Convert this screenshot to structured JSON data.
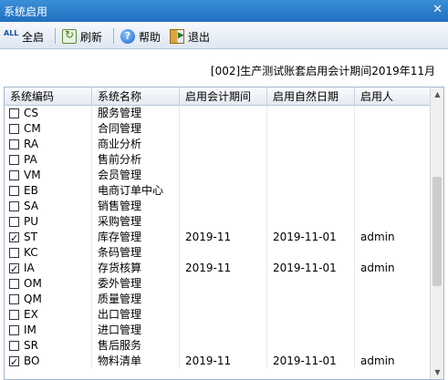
{
  "window": {
    "title": "系统启用",
    "close_glyph": "✕"
  },
  "toolbar": {
    "all_icon_text": "ALL",
    "all_label": "全启",
    "refresh_label": "刷新",
    "help_label": "帮助",
    "exit_label": "退出"
  },
  "period_text": "[002]生产测试账套启用会计期间2019年11月",
  "table": {
    "headers": [
      "系统编码",
      "系统名称",
      "启用会计期间",
      "启用自然日期",
      "启用人"
    ],
    "rows": [
      {
        "checked": false,
        "code": "CS",
        "name": "服务管理",
        "period": "",
        "date": "",
        "user": ""
      },
      {
        "checked": false,
        "code": "CM",
        "name": "合同管理",
        "period": "",
        "date": "",
        "user": ""
      },
      {
        "checked": false,
        "code": "RA",
        "name": "商业分析",
        "period": "",
        "date": "",
        "user": ""
      },
      {
        "checked": false,
        "code": "PA",
        "name": "售前分析",
        "period": "",
        "date": "",
        "user": ""
      },
      {
        "checked": false,
        "code": "VM",
        "name": "会员管理",
        "period": "",
        "date": "",
        "user": ""
      },
      {
        "checked": false,
        "code": "EB",
        "name": "电商订单中心",
        "period": "",
        "date": "",
        "user": ""
      },
      {
        "checked": false,
        "code": "SA",
        "name": "销售管理",
        "period": "",
        "date": "",
        "user": ""
      },
      {
        "checked": false,
        "code": "PU",
        "name": "采购管理",
        "period": "",
        "date": "",
        "user": ""
      },
      {
        "checked": true,
        "code": "ST",
        "name": "库存管理",
        "period": "2019-11",
        "date": "2019-11-01",
        "user": "admin"
      },
      {
        "checked": false,
        "code": "KC",
        "name": "条码管理",
        "period": "",
        "date": "",
        "user": ""
      },
      {
        "checked": true,
        "code": "IA",
        "name": "存货核算",
        "period": "2019-11",
        "date": "2019-11-01",
        "user": "admin"
      },
      {
        "checked": false,
        "code": "OM",
        "name": "委外管理",
        "period": "",
        "date": "",
        "user": ""
      },
      {
        "checked": false,
        "code": "QM",
        "name": "质量管理",
        "period": "",
        "date": "",
        "user": ""
      },
      {
        "checked": false,
        "code": "EX",
        "name": "出口管理",
        "period": "",
        "date": "",
        "user": ""
      },
      {
        "checked": false,
        "code": "IM",
        "name": "进口管理",
        "period": "",
        "date": "",
        "user": ""
      },
      {
        "checked": false,
        "code": "SR",
        "name": "售后服务",
        "period": "",
        "date": "",
        "user": ""
      },
      {
        "checked": true,
        "code": "BO",
        "name": "物料清单",
        "period": "2019-11",
        "date": "2019-11-01",
        "user": "admin"
      }
    ]
  },
  "scrollbar": {
    "up_glyph": "▲",
    "down_glyph": "▼"
  }
}
